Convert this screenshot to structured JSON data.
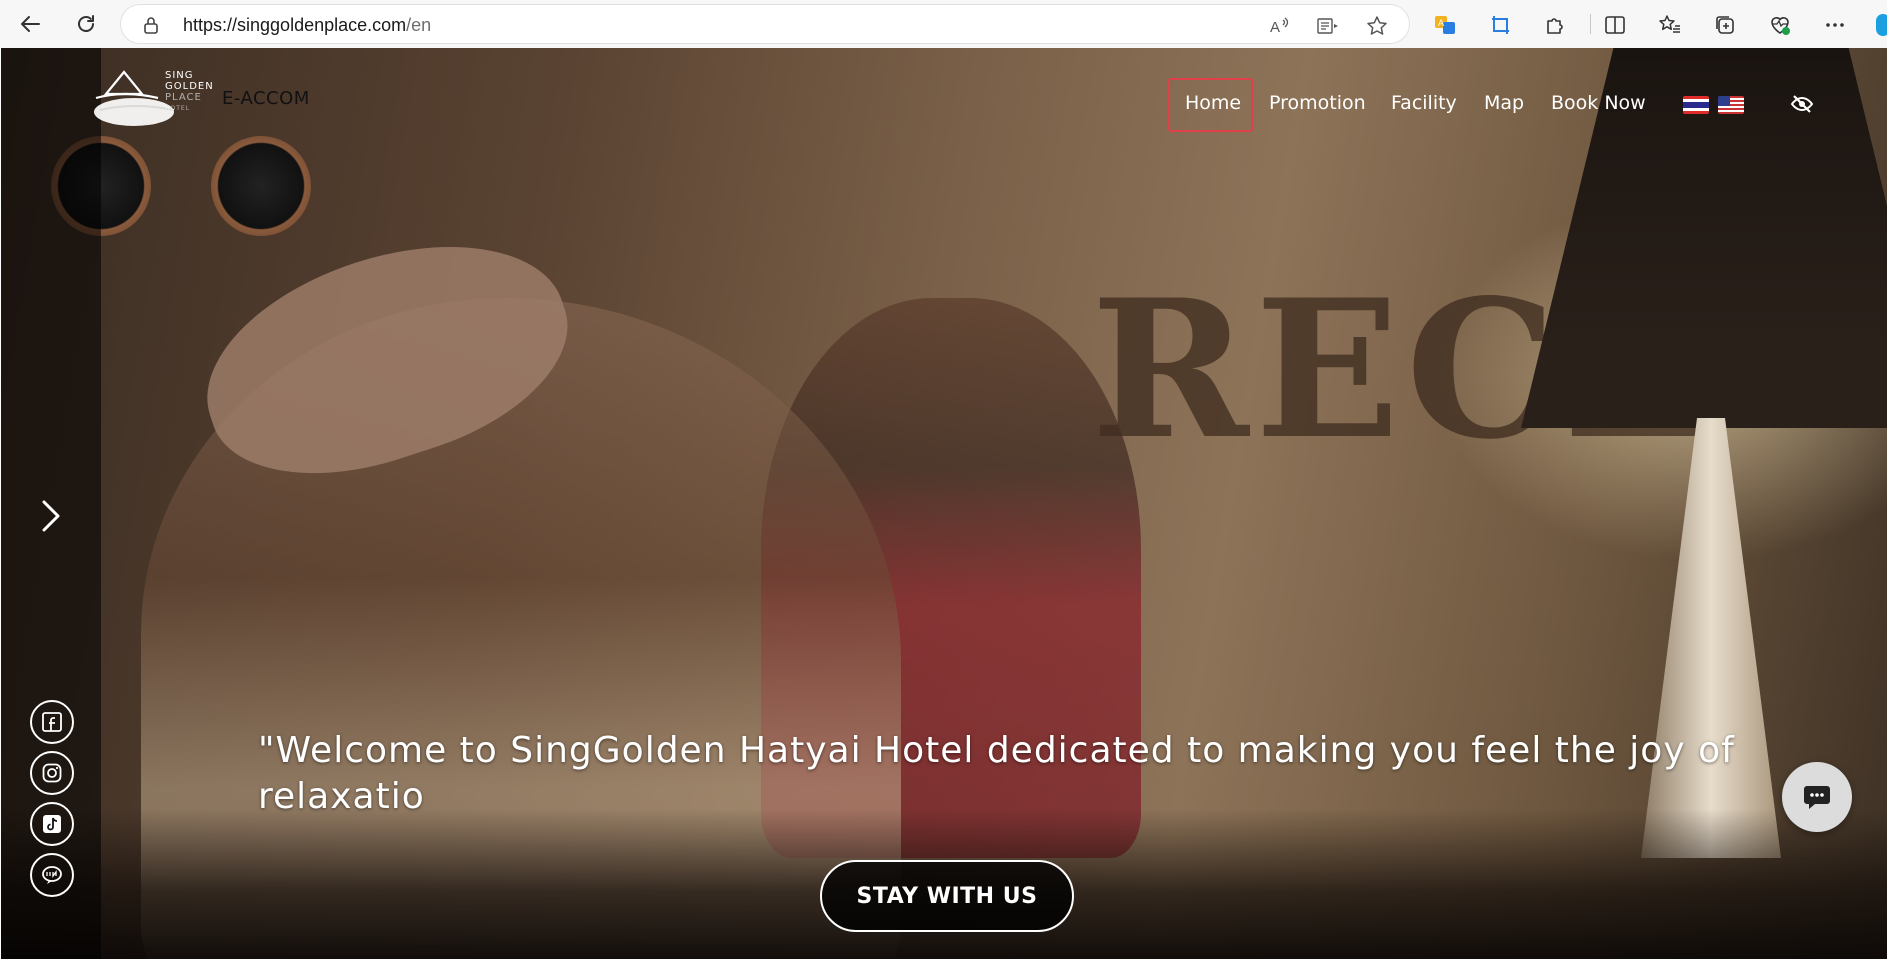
{
  "browser": {
    "url_host": "https://singgoldenplace.com",
    "url_path": "/en",
    "icons": {
      "back": "back-arrow-icon",
      "reload": "reload-icon",
      "lock": "lock-icon",
      "read_aloud": "read-aloud-icon",
      "immersive_reader": "immersive-reader-icon",
      "favorite": "star-icon",
      "translate": "translate-icon",
      "screen_capture": "screen-capture-icon",
      "extensions": "puzzle-icon",
      "split_screen": "split-screen-icon",
      "favorites_bar": "favorites-icon",
      "collections": "collections-icon",
      "browser_essentials": "heart-pulse-icon",
      "more": "more-icon"
    }
  },
  "site": {
    "logo_lines": [
      "SING",
      "GOLDEN",
      "PLACE",
      "HOTEL"
    ],
    "brand": "E-ACCOM",
    "menu": [
      {
        "label": "Home",
        "active": true
      },
      {
        "label": "Promotion",
        "active": false
      },
      {
        "label": "Facility",
        "active": false
      },
      {
        "label": "Map",
        "active": false
      },
      {
        "label": "Book Now",
        "active": false
      }
    ],
    "languages": [
      "th",
      "en"
    ],
    "accent_color": "#e0404a"
  },
  "hero": {
    "background_sign": "RECE",
    "headline": "\"Welcome to SingGolden Hatyai Hotel dedicated to making you feel the joy of relaxatio",
    "cta_label": "STAY WITH US",
    "social": [
      "facebook-icon",
      "instagram-icon",
      "tiktok-icon",
      "line-icon"
    ]
  }
}
